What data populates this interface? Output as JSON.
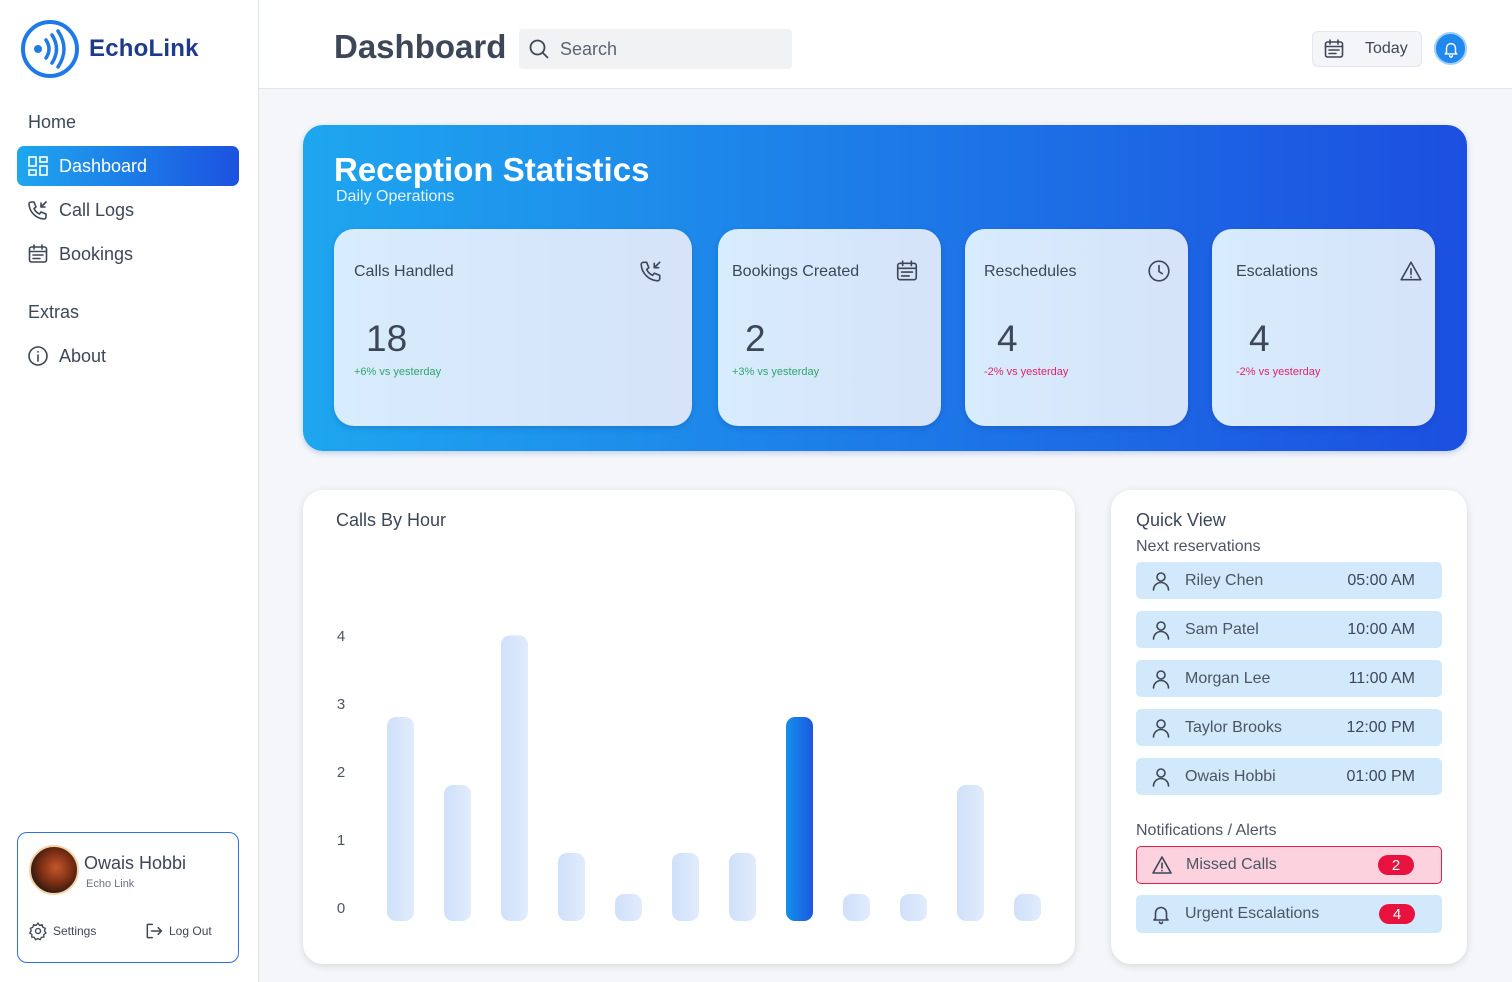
{
  "app": {
    "name": "EchoLink"
  },
  "sidebar": {
    "sections": [
      {
        "title": "Home"
      },
      {
        "title": "Extras"
      }
    ],
    "items": [
      {
        "label": "Dashboard",
        "icon": "dashboard-icon",
        "active": true
      },
      {
        "label": "Call Logs",
        "icon": "phone-incoming-icon"
      },
      {
        "label": "Bookings",
        "icon": "calendar-icon"
      },
      {
        "label": "About",
        "icon": "info-icon"
      }
    ],
    "profile": {
      "name": "Owais Hobbi",
      "org": "Echo Link",
      "settings_label": "Settings",
      "logout_label": "Log Out"
    }
  },
  "header": {
    "title": "Dashboard",
    "search_placeholder": "Search",
    "date_filter": "Today"
  },
  "stats": {
    "title": "Reception Statistics",
    "subtitle": "Daily Operations",
    "cards": [
      {
        "label": "Calls Handled",
        "value": "18",
        "delta": "+6% vs yesterday",
        "trend": "up",
        "icon": "phone-incoming-icon"
      },
      {
        "label": "Bookings Created",
        "value": "2",
        "delta": "+3% vs yesterday",
        "trend": "up",
        "icon": "calendar-icon"
      },
      {
        "label": "Reschedules",
        "value": "4",
        "delta": "-2% vs yesterday",
        "trend": "down",
        "icon": "clock-icon"
      },
      {
        "label": "Escalations",
        "value": "4",
        "delta": "-2% vs yesterday",
        "trend": "down",
        "icon": "warning-icon"
      }
    ]
  },
  "chart": {
    "title": "Calls By Hour"
  },
  "chart_data": {
    "type": "bar",
    "title": "Calls By Hour",
    "xlabel": "",
    "ylabel": "",
    "categories": [
      "",
      "",
      "",
      "",
      "",
      "",
      "",
      "",
      "",
      "",
      "",
      ""
    ],
    "values": [
      3,
      2,
      4.2,
      1,
      0.3,
      1,
      1,
      3,
      0.3,
      0.3,
      2,
      0.25
    ],
    "highlight_index": 7,
    "y_ticks": [
      0,
      1,
      2,
      3,
      4
    ],
    "ylim": [
      0,
      4.4
    ],
    "grid": false,
    "colors": {
      "bar": "#d6e6fb",
      "highlight": "#1c6fe6"
    }
  },
  "quick_view": {
    "title": "Quick View",
    "reservations_title": "Next reservations",
    "reservations": [
      {
        "name": "Riley Chen",
        "time": "05:00 AM"
      },
      {
        "name": "Sam Patel",
        "time": "10:00 AM"
      },
      {
        "name": "Morgan Lee",
        "time": "11:00 AM"
      },
      {
        "name": "Taylor Brooks",
        "time": "12:00 PM"
      },
      {
        "name": "Owais Hobbi",
        "time": "01:00 PM"
      }
    ],
    "alerts_title": "Notifications / Alerts",
    "alerts": [
      {
        "label": "Missed Calls",
        "count": "2",
        "icon": "warning-icon"
      },
      {
        "label": "Urgent Escalations",
        "count": "4",
        "icon": "bell-icon"
      }
    ]
  },
  "colors": {
    "accent_start": "#1ea7ef",
    "accent_end": "#1c52e0",
    "positive": "#2fa56d",
    "negative": "#e0246b",
    "alert_red": "#e8123f"
  }
}
